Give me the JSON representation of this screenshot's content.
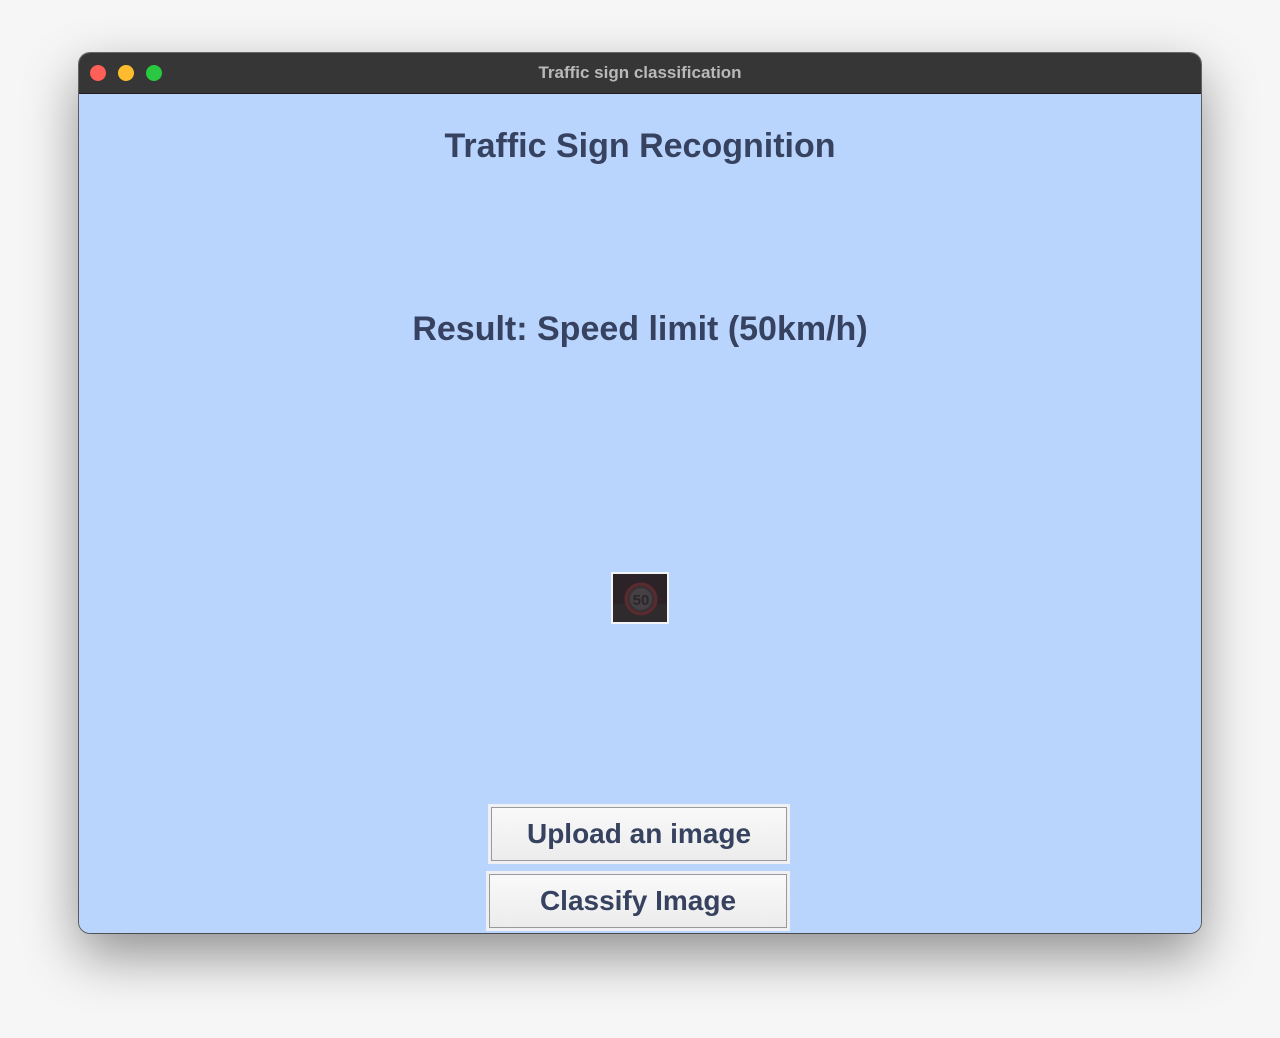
{
  "window": {
    "title": "Traffic sign classification"
  },
  "main": {
    "heading": "Traffic Sign Recognition",
    "result_text": "Result: Speed limit (50km/h)",
    "uploaded_image": {
      "sign_number": "50"
    }
  },
  "buttons": {
    "upload_label": "Upload an image",
    "classify_label": "Classify Image"
  },
  "colors": {
    "background": "#b9d4fd",
    "text": "#364260",
    "titlebar": "#363636",
    "close": "#fe5f57",
    "minimize": "#febb2e",
    "maximize": "#29c840"
  },
  "icons": [
    "close-window-icon",
    "minimize-window-icon",
    "maximize-window-icon"
  ]
}
